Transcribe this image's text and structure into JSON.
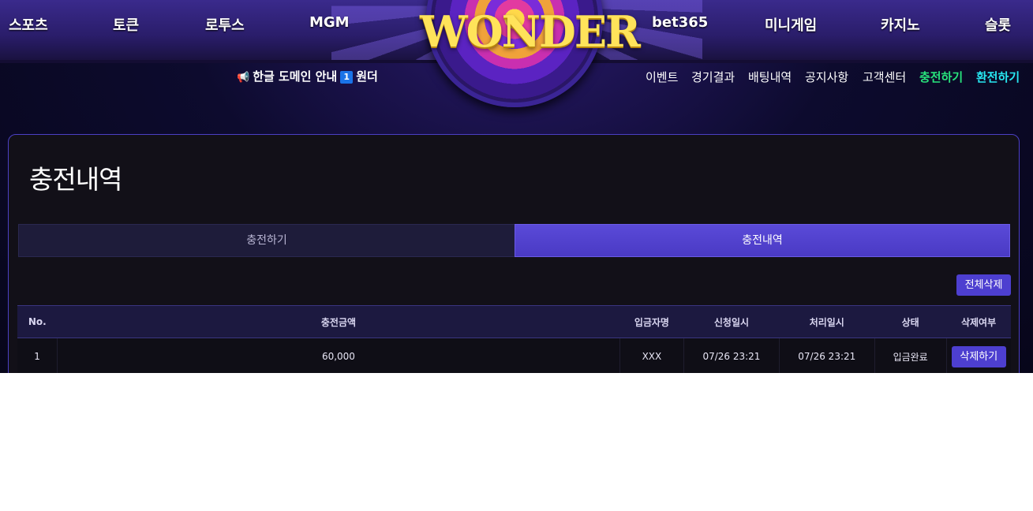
{
  "header": {
    "logo_text": "WONDER",
    "main_nav_left": [
      "스포츠",
      "토큰",
      "로투스",
      "MGM"
    ],
    "main_nav_right": [
      "bet365",
      "미니게임",
      "카지노",
      "슬롯"
    ],
    "notice_icon": "megaphone-icon",
    "notice_text": "한글 도메인 안내",
    "notice_badge": "1",
    "notice_text2": "원더",
    "sub_nav": [
      "이벤트",
      "경기결과",
      "배팅내역",
      "공지사항",
      "고객센터"
    ],
    "charge_label": "충전하기",
    "exchange_label": "환전하기"
  },
  "colors": {
    "charge": "#28e37c",
    "exchange": "#27e6f0",
    "accent": "#4d3fd0"
  },
  "page": {
    "title": "충전내역",
    "tabs": [
      "충전하기",
      "충전내역"
    ],
    "active_tab": "충전내역",
    "delete_all_label": "전체삭제"
  },
  "table": {
    "headers": [
      "No.",
      "충전금액",
      "입금자명",
      "신청일시",
      "처리일시",
      "상태",
      "삭제여부"
    ],
    "rows": [
      {
        "no": "1",
        "amount": "60,000",
        "depositor": "XXX",
        "requested": "07/26 23:21",
        "processed": "07/26 23:21",
        "status": "입금완료",
        "action": "삭제하기"
      }
    ]
  }
}
